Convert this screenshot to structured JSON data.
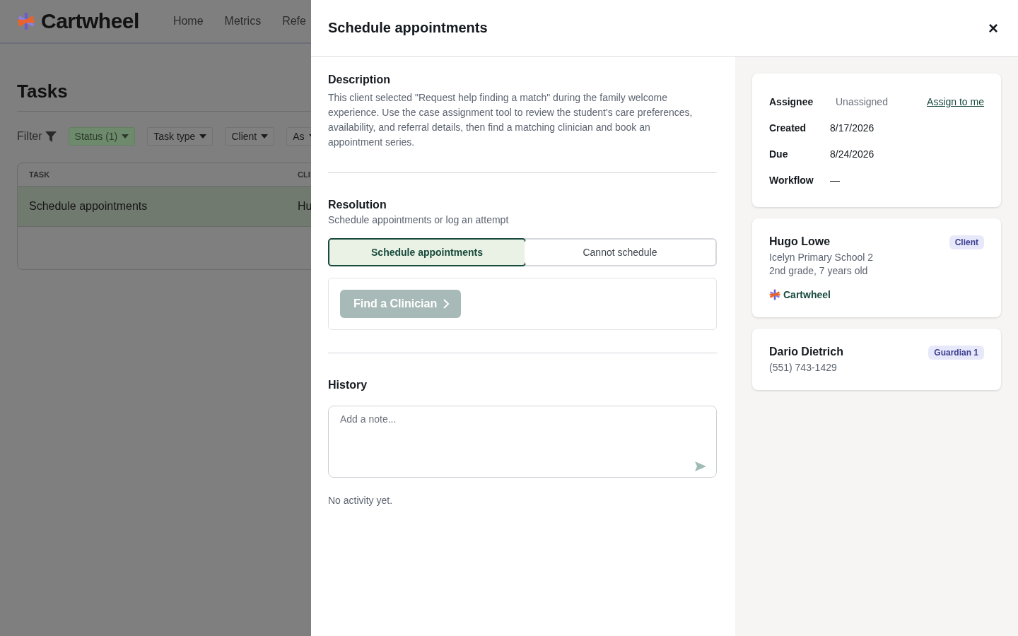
{
  "background": {
    "brand": "Cartwheel",
    "nav": [
      "Home",
      "Metrics",
      "Refe"
    ],
    "page_title": "Tasks",
    "filter_label": "Filter",
    "filters": [
      {
        "label": "Status (1)",
        "active": true
      },
      {
        "label": "Task type",
        "active": false
      },
      {
        "label": "Client",
        "active": false
      },
      {
        "label": "As",
        "active": false
      }
    ],
    "table": {
      "columns": [
        "TASK",
        "CLI"
      ],
      "rows": [
        {
          "cells": [
            "Schedule appointments",
            "Hu"
          ],
          "selected": true
        }
      ]
    }
  },
  "drawer": {
    "title": "Schedule appointments",
    "close": "×",
    "description": {
      "heading": "Description",
      "text": "This client selected \"Request help finding a match\" during the family welcome experience. Use the case assignment tool to review the student's care preferences, availability, and referral details, then find a matching clinician and book an appointment series."
    },
    "resolution": {
      "heading": "Resolution",
      "subtitle": "Schedule appointments or log an attempt",
      "options": [
        {
          "label": "Schedule appointments",
          "selected": true
        },
        {
          "label": "Cannot schedule",
          "selected": false
        }
      ],
      "action": {
        "label": "Find a Clinician",
        "disabled": true
      }
    },
    "history": {
      "heading": "History",
      "placeholder": "Add a note...",
      "empty": "No activity yet."
    },
    "details": [
      {
        "label": "Assignee",
        "value": "Unassigned",
        "muted": true,
        "link": "Assign to me"
      },
      {
        "label": "Created",
        "value": "8/17/2026",
        "muted": false
      },
      {
        "label": "Due",
        "value": "8/24/2026",
        "muted": false
      },
      {
        "label": "Workflow",
        "value": "—",
        "muted": false
      }
    ],
    "contacts": [
      {
        "name": "Hugo Lowe",
        "tag": "Client",
        "lines": [
          "Icelyn Primary School 2",
          "2nd grade, 7 years old"
        ],
        "org": "Cartwheel"
      },
      {
        "name": "Dario Dietrich",
        "tag": "Guardian 1",
        "lines": [
          "(551) 743-1429"
        ]
      }
    ]
  }
}
